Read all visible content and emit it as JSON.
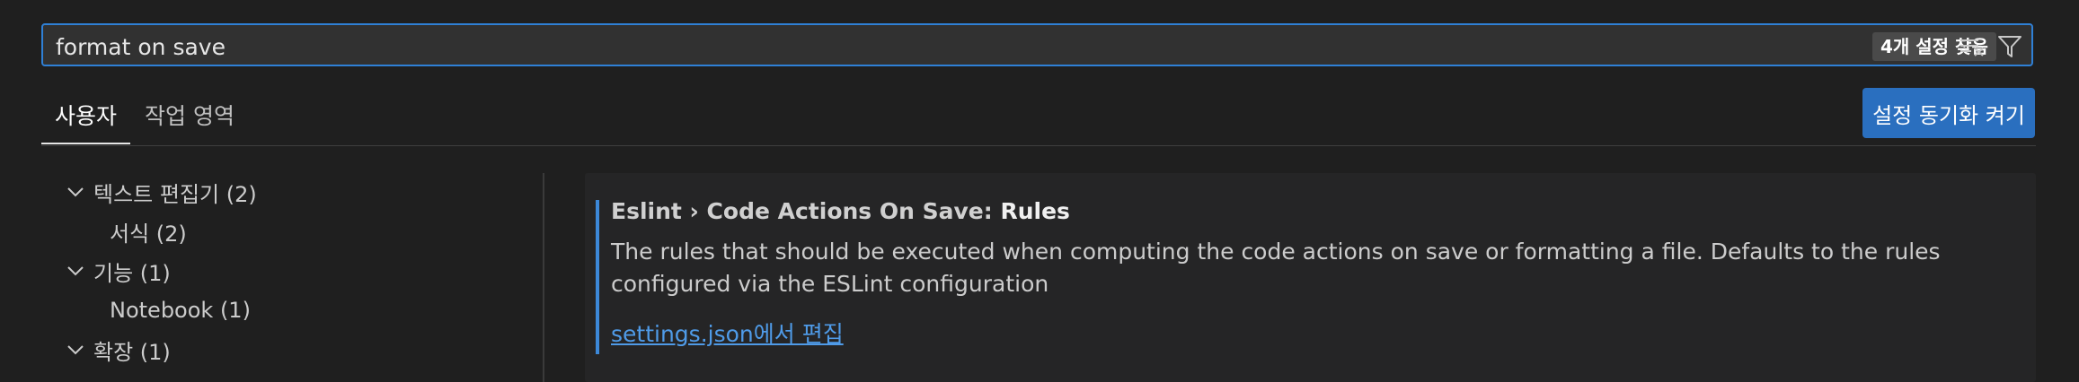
{
  "search": {
    "value": "format on save",
    "result_count": "4개 설정 찾음"
  },
  "tabs": [
    {
      "label": "사용자",
      "active": true
    },
    {
      "label": "작업 영역",
      "active": false
    }
  ],
  "sync_button": {
    "label": "설정 동기화 켜기"
  },
  "toc": {
    "items": [
      {
        "label": "텍스트 편집기 (2)",
        "expanded": true,
        "level": 0
      },
      {
        "label": "서식 (2)",
        "level": 1
      },
      {
        "label": "기능 (1)",
        "expanded": true,
        "level": 0
      },
      {
        "label": "Notebook (1)",
        "level": 1
      },
      {
        "label": "확장 (1)",
        "expanded": true,
        "level": 0
      }
    ]
  },
  "setting": {
    "category": "Eslint › Code Actions On Save: ",
    "key": "Rules",
    "description": "The rules that should be executed when computing the code actions on save or formatting a file. Defaults to the rules configured via the ESLint configuration",
    "link": "settings.json에서 편집"
  },
  "colors": {
    "accent": "#2a6fbf",
    "focus_border": "#2f80d6",
    "link": "#4f9be8",
    "background": "#1f1f1f"
  }
}
